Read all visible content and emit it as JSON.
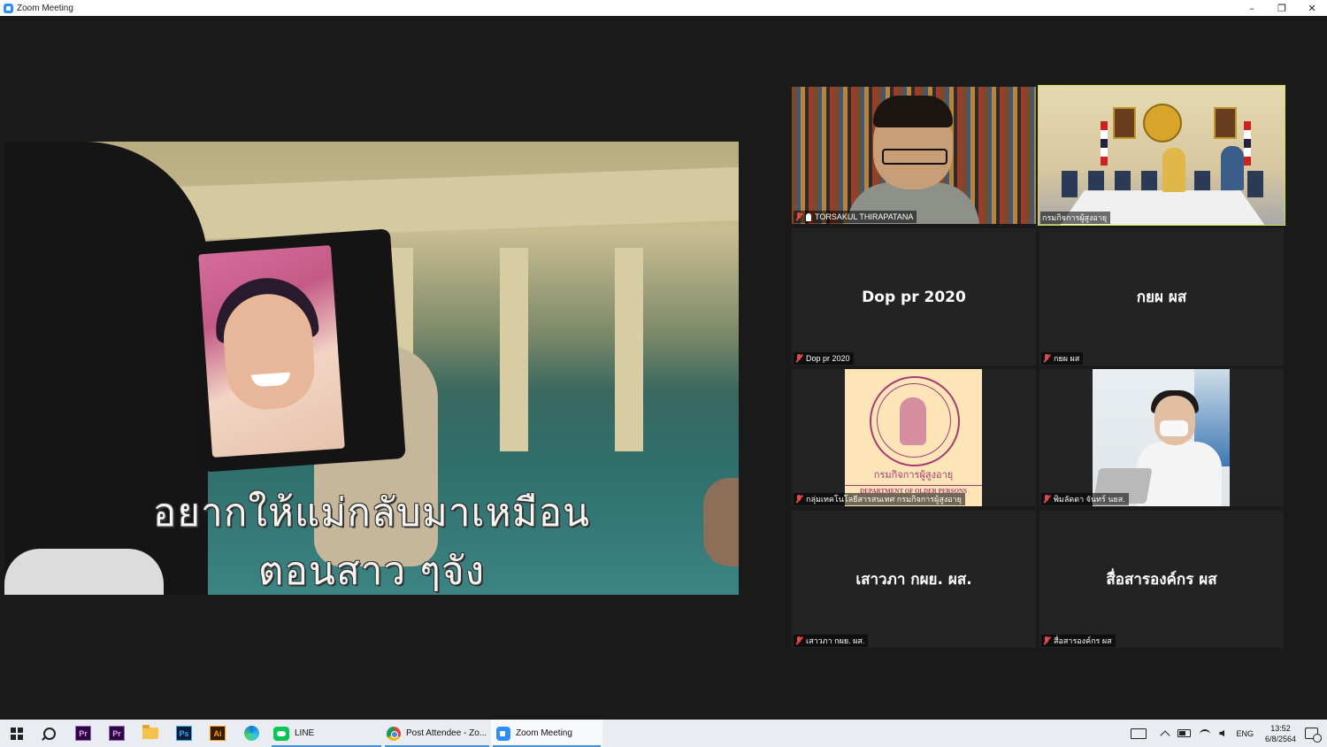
{
  "window": {
    "title": "Zoom Meeting",
    "controls": {
      "minimize": "–",
      "restore": "❐",
      "close": "✕"
    }
  },
  "share": {
    "subtitle_line1": "อยากให้แม่กลับมาเหมือน",
    "subtitle_line2": "ตอนสาว ๆจัง"
  },
  "gallery": {
    "tiles": [
      {
        "display_name": "",
        "label": "TORSAKUL THIRAPATANA",
        "muted": true,
        "pinned": true,
        "video": true,
        "active": false
      },
      {
        "display_name": "",
        "label": "กรมกิจการผู้สูงอายุ",
        "muted": false,
        "pinned": false,
        "video": true,
        "active": true
      },
      {
        "display_name": "Dop pr 2020",
        "label": "Dop pr 2020",
        "muted": true,
        "video": false
      },
      {
        "display_name": "กยผ ผส",
        "label": "กยผ ผส",
        "muted": true,
        "video": false
      },
      {
        "display_name": "",
        "label": "กลุ่มเทคโนโลยีสารสนเทศ กรมกิจการผู้สูงอายุ",
        "muted": true,
        "video": true,
        "logo_text_th": "กรมกิจการผู้สูงอายุ",
        "logo_text_en": "DEPARTMENT OF OLDER PERSONS"
      },
      {
        "display_name": "",
        "label": "พิมลัดดา จันทร์ นยส.",
        "muted": true,
        "video": true
      },
      {
        "display_name": "เสาวภา กผย. ผส.",
        "label": "เสาวภา กผย. ผส.",
        "muted": true,
        "video": false
      },
      {
        "display_name": "สื่อสารองค์กร ผส",
        "label": "สื่อสารองค์กร ผส",
        "muted": true,
        "video": false
      }
    ]
  },
  "taskbar": {
    "pinned": [
      {
        "name": "premiere-pro",
        "text": "Pr"
      },
      {
        "name": "premiere-rush",
        "text": "Pr"
      },
      {
        "name": "file-explorer",
        "text": ""
      },
      {
        "name": "photoshop",
        "text": "Ps"
      },
      {
        "name": "illustrator",
        "text": "Ai"
      },
      {
        "name": "edge",
        "text": ""
      }
    ],
    "apps": [
      {
        "name": "line",
        "label": "LINE"
      },
      {
        "name": "chrome",
        "label": "Post Attendee - Zo..."
      },
      {
        "name": "zoom",
        "label": "Zoom Meeting"
      }
    ],
    "tray": {
      "language": "ENG",
      "time": "13:52",
      "date": "6/8/2564"
    }
  },
  "colors": {
    "active_speaker": "#c8e34b",
    "muted_mic": "#e04a4a",
    "background": "#1a1a1a",
    "zoom_blue": "#2d8cff"
  }
}
